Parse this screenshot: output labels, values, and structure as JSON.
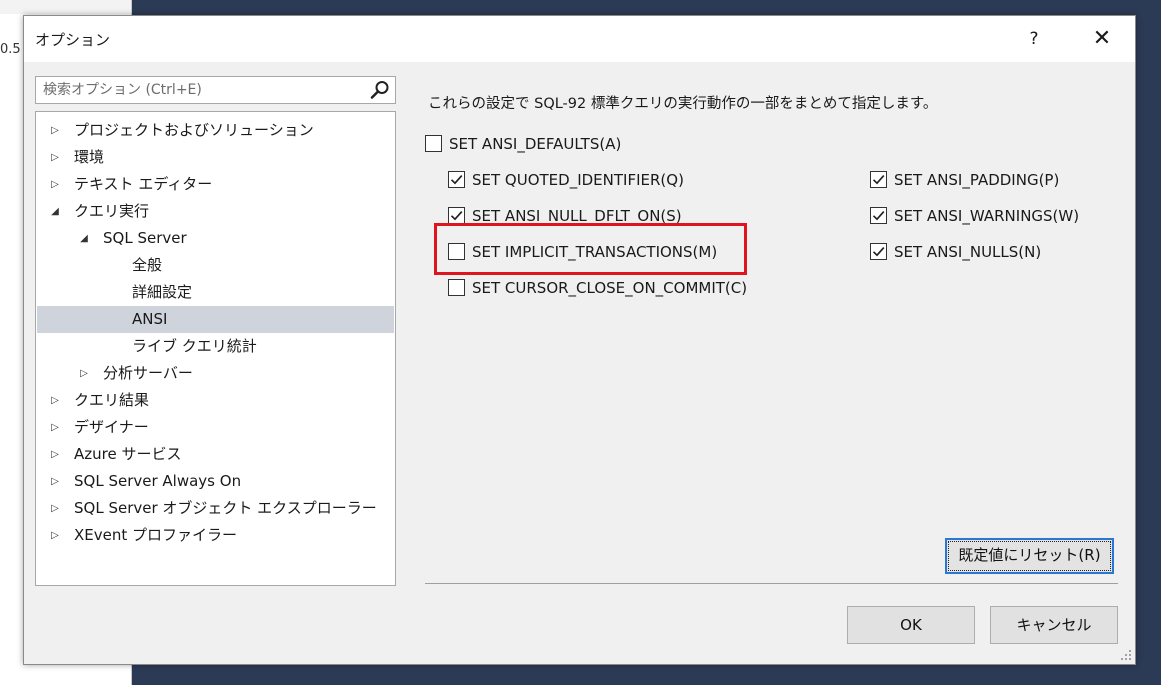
{
  "background": {
    "left_value": "0.5"
  },
  "dialog": {
    "title": "オプション",
    "help_label": "?",
    "close_label": "✕"
  },
  "search": {
    "placeholder": "検索オプション (Ctrl+E)"
  },
  "tree": [
    {
      "label": "プロジェクトおよびソリューション",
      "arrow": "▷",
      "selected": false
    },
    {
      "label": "環境",
      "arrow": "▷",
      "selected": false
    },
    {
      "label": "テキスト エディター",
      "arrow": "▷",
      "selected": false
    },
    {
      "label": "クエリ実行",
      "arrow": "◢",
      "selected": false
    },
    {
      "label": "SQL Server",
      "arrow": "◢",
      "selected": false
    },
    {
      "label": "全般",
      "arrow": "",
      "selected": false
    },
    {
      "label": "詳細設定",
      "arrow": "",
      "selected": false
    },
    {
      "label": "ANSI",
      "arrow": "",
      "selected": true
    },
    {
      "label": "ライブ クエリ統計",
      "arrow": "",
      "selected": false
    },
    {
      "label": "分析サーバー",
      "arrow": "▷",
      "selected": false
    },
    {
      "label": "クエリ結果",
      "arrow": "▷",
      "selected": false
    },
    {
      "label": "デザイナー",
      "arrow": "▷",
      "selected": false
    },
    {
      "label": "Azure サービス",
      "arrow": "▷",
      "selected": false
    },
    {
      "label": "SQL Server Always On",
      "arrow": "▷",
      "selected": false
    },
    {
      "label": "SQL Server オブジェクト エクスプローラー",
      "arrow": "▷",
      "selected": false
    },
    {
      "label": "XEvent プロファイラー",
      "arrow": "▷",
      "selected": false
    }
  ],
  "description": "これらの設定で SQL-92 標準クエリの実行動作の一部をまとめて指定します。",
  "options": {
    "ansi_defaults": {
      "label": "SET ANSI_DEFAULTS(A)",
      "checked": false
    },
    "quoted_identifier": {
      "label": "SET QUOTED_IDENTIFIER(Q)",
      "checked": true
    },
    "ansi_null_dflt_on": {
      "label": "SET ANSI_NULL_DFLT_ON(S)",
      "checked": true
    },
    "implicit_transactions": {
      "label": "SET IMPLICIT_TRANSACTIONS(M)",
      "checked": false
    },
    "cursor_close_on_commit": {
      "label": "SET CURSOR_CLOSE_ON_COMMIT(C)",
      "checked": false
    },
    "ansi_padding": {
      "label": "SET ANSI_PADDING(P)",
      "checked": true
    },
    "ansi_warnings": {
      "label": "SET ANSI_WARNINGS(W)",
      "checked": true
    },
    "ansi_nulls": {
      "label": "SET ANSI_NULLS(N)",
      "checked": true
    }
  },
  "buttons": {
    "reset_label": "既定値にリセット(R)",
    "ok_label": "OK",
    "cancel_label": "キャンセル"
  },
  "colors": {
    "highlight": "#e0141e",
    "focus_border": "#2b78d4",
    "selection": "#cfd3dc"
  }
}
